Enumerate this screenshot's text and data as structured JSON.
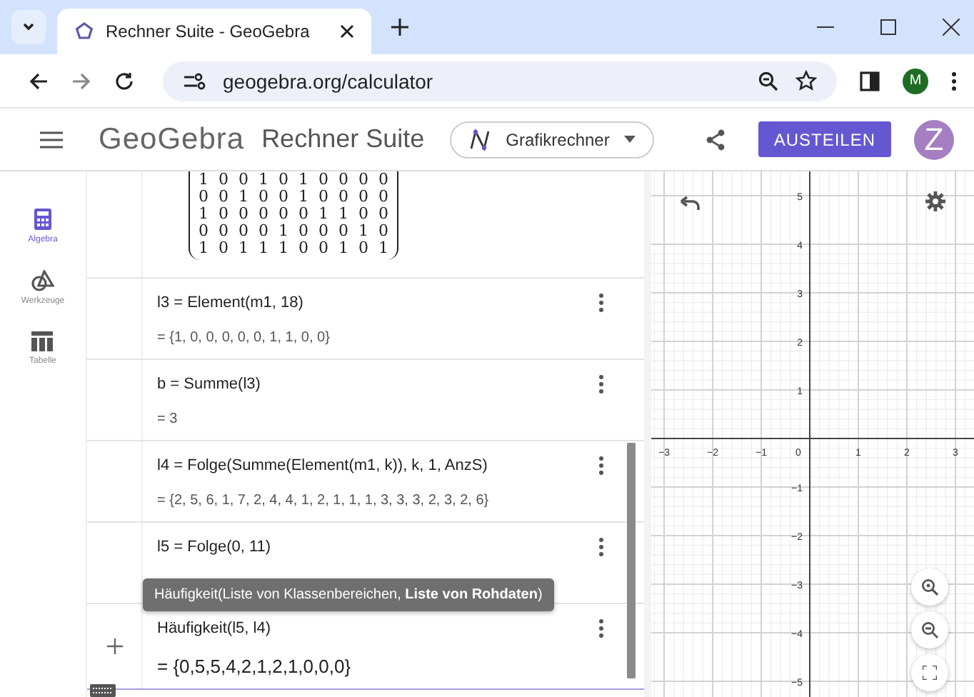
{
  "browser": {
    "tab_title": "Rechner Suite - GeoGebra",
    "url": "geogebra.org/calculator",
    "profile_initial": "M"
  },
  "header": {
    "logo": "GeoGebra",
    "suite": "Rechner Suite",
    "app_selector": "Grafikrechner",
    "share_button": "AUSTEILEN",
    "avatar": "Z"
  },
  "sidebar": [
    {
      "label": "Algebra",
      "kind": "algebra",
      "selected": true
    },
    {
      "label": "Werkzeuge",
      "kind": "tools",
      "selected": false
    },
    {
      "label": "Tabelle",
      "kind": "table",
      "selected": false
    }
  ],
  "algebra": [
    {
      "kind": "matrix",
      "active": false,
      "rows": [
        [
          "1",
          "0",
          "0",
          "1",
          "0",
          "1",
          "0",
          "0",
          "0",
          "0"
        ],
        [
          "0",
          "0",
          "1",
          "0",
          "0",
          "1",
          "0",
          "0",
          "0",
          "0"
        ],
        [
          "1",
          "0",
          "0",
          "0",
          "0",
          "0",
          "1",
          "1",
          "0",
          "0"
        ],
        [
          "0",
          "0",
          "0",
          "0",
          "1",
          "0",
          "0",
          "0",
          "1",
          "0"
        ],
        [
          "1",
          "0",
          "1",
          "1",
          "1",
          "0",
          "0",
          "1",
          "0",
          "1"
        ]
      ]
    },
    {
      "kind": "expression",
      "active": false,
      "input": "l3 = Element(m1, 18)",
      "output": "= {1, 0, 0, 0, 0, 0, 1, 1, 0, 0}"
    },
    {
      "kind": "expression",
      "active": false,
      "input": "b = Summe(l3)",
      "output": "= 3"
    },
    {
      "kind": "expression",
      "active": false,
      "input": "l4 = Folge(Summe(Element(m1, k)), k, 1, AnzS)",
      "output": "= {2, 5, 6, 1, 7, 2, 4, 4, 1, 2, 1, 1, 1, 3, 3, 3, 2, 3, 2, 6}"
    },
    {
      "kind": "expression",
      "active": false,
      "input": "l5 = Folge(0, 11)",
      "tooltip": "Häufigkeit(Liste von Klassenbereichen, **Liste von Rohdaten**)"
    },
    {
      "kind": "expression",
      "active": true,
      "input": "Häufigkeit(l5, l4)",
      "output": "=  {0,5,5,4,2,1,2,1,0,0,0}"
    }
  ],
  "graph": {
    "x_labels": [
      "−3",
      "−2",
      "−1",
      "0",
      "1",
      "2",
      "3"
    ],
    "y_labels": [
      "5",
      "4",
      "3",
      "2",
      "1",
      "−1",
      "−2",
      "−3",
      "−4",
      "−5"
    ]
  }
}
